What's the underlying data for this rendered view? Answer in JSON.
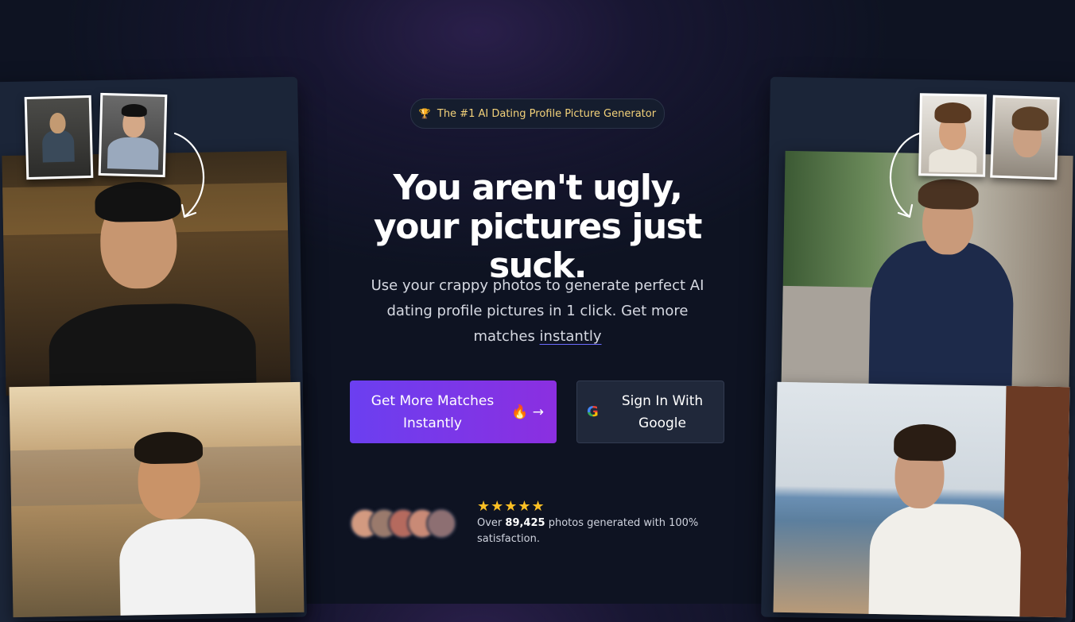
{
  "badge": {
    "icon": "trophy-icon",
    "text": "The #1 AI Dating Profile Picture Generator"
  },
  "hero": {
    "headline": "You aren't ugly, your pictures just suck.",
    "subtext_before": "Use your crappy photos to generate perfect AI dating profile pictures in 1 click. Get more matches ",
    "subtext_underlined": "instantly"
  },
  "cta": {
    "primary_label": "Get More Matches Instantly",
    "primary_icons": "🔥 →",
    "google_label": "Sign In With Google",
    "google_icon": "G"
  },
  "social_proof": {
    "stars": "★★★★★",
    "text_before": "Over ",
    "count": "89,425",
    "text_after": " photos generated with 100% satisfaction."
  },
  "colors": {
    "background": "#0e1322",
    "accent_start": "#6b3ff0",
    "accent_end": "#8b2fe0",
    "star": "#fbbf24",
    "badge_text": "#f3d27a"
  }
}
